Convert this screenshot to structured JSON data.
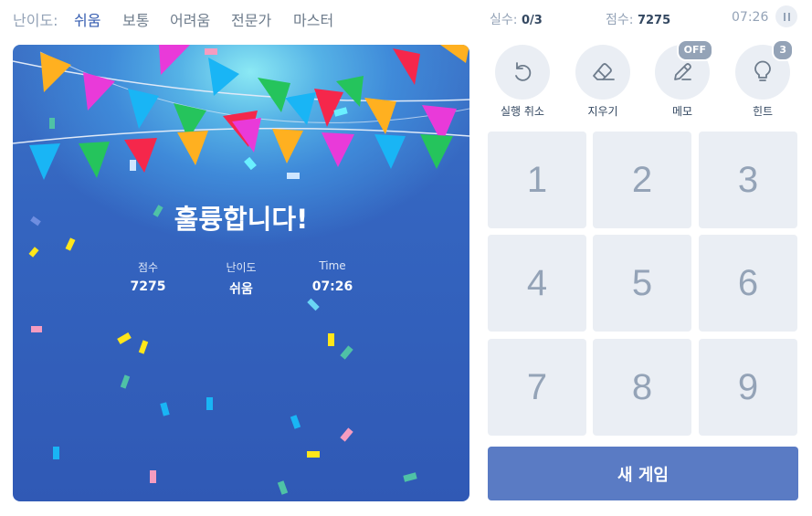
{
  "header": {
    "difficulty_label": "난이도:",
    "difficulties": [
      "쉬움",
      "보통",
      "어려움",
      "전문가",
      "마스터"
    ],
    "active_difficulty": "쉬움",
    "mistakes_label": "실수:",
    "mistakes_value": "0/3",
    "score_label": "점수:",
    "score_value": "7275",
    "timer": "07:26"
  },
  "result": {
    "title": "훌륭합니다!",
    "score_label": "점수",
    "score_value": "7275",
    "difficulty_label": "난이도",
    "difficulty_value": "쉬움",
    "time_label": "Time",
    "time_value": "07:26"
  },
  "tools": [
    {
      "name": "undo",
      "label": "실행 취소",
      "icon": "undo-icon"
    },
    {
      "name": "erase",
      "label": "지우기",
      "icon": "eraser-icon"
    },
    {
      "name": "notes",
      "label": "메모",
      "icon": "pencil-icon",
      "badge": "OFF"
    },
    {
      "name": "hint",
      "label": "힌트",
      "icon": "lightbulb-icon",
      "badge": "3"
    }
  ],
  "numpad": [
    "1",
    "2",
    "3",
    "4",
    "5",
    "6",
    "7",
    "8",
    "9"
  ],
  "new_game_label": "새 게임",
  "colors": {
    "accent": "#325aaf",
    "board_blue": "#3465c0",
    "button": "#5a7bc4",
    "tile": "#eaeef4"
  }
}
